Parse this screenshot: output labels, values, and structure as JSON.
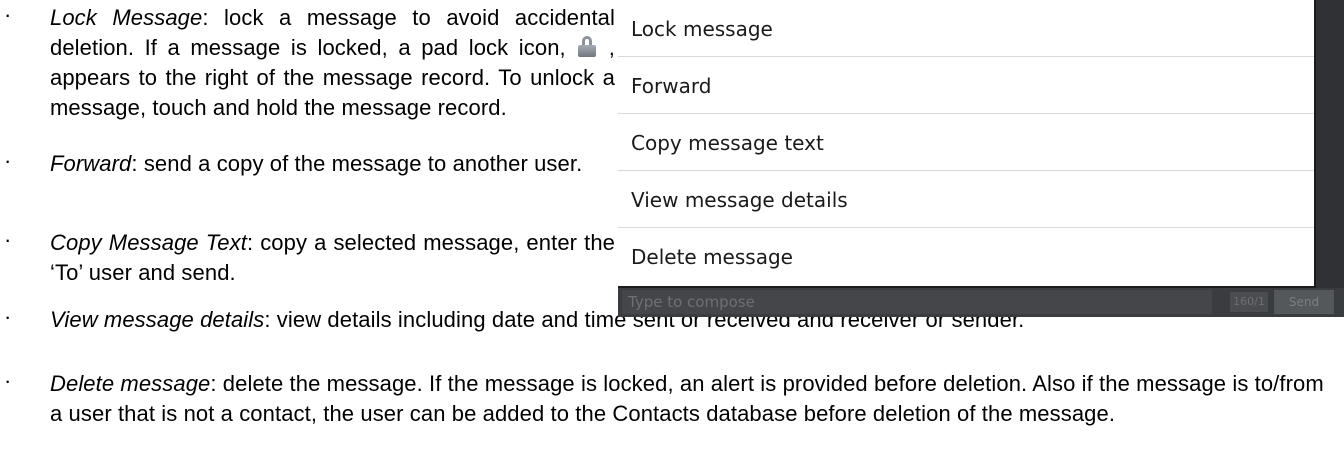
{
  "bullet_glyph": "·",
  "items": [
    {
      "term": "Lock Message",
      "sep": ":",
      "text_before_icon": " lock a message to avoid accidental deletion.  If a message is locked, a pad lock icon, ",
      "icon": "padlock-icon",
      "text_after_icon": " , appears to the right of the message record.   To unlock a message, touch and hold the message record."
    },
    {
      "term": "Forward",
      "sep": ":",
      "text": " send a copy of the message to another user."
    },
    {
      "term": "Copy Message Text",
      "sep": ":",
      "text": " copy a selected message, enter the ‘To’ user and send."
    },
    {
      "term": "View message details",
      "sep": ":",
      "text": " view details including date and time sent or received and receiver or sender."
    },
    {
      "term": "Delete message",
      "sep": ":",
      "text": " delete the message.  If the message is locked, an alert is provided before deletion.  Also if the message is to/from a user that is not a contact, the user can be added to the Contacts database before deletion of the message."
    }
  ],
  "context_menu": {
    "items": [
      "Lock message",
      "Forward",
      "Copy message text",
      "View message details",
      "Delete message"
    ]
  },
  "compose": {
    "placeholder": "Type to compose",
    "counter": "160/1",
    "send_label": "Send"
  }
}
